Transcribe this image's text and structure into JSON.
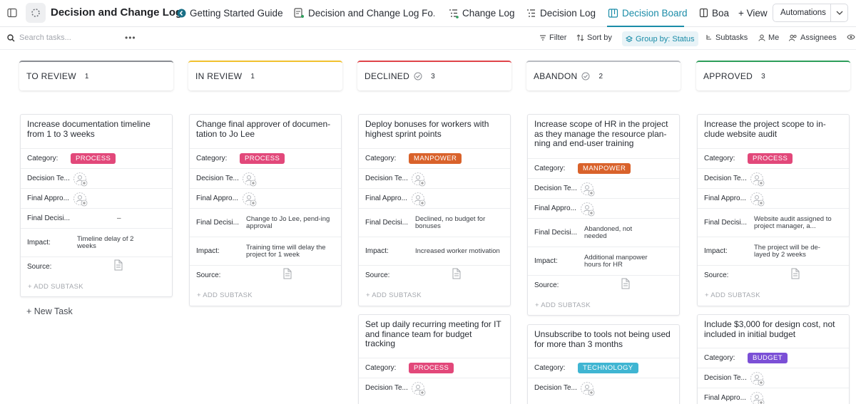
{
  "header": {
    "title": "Decision and Change Log",
    "tabs": [
      {
        "label": "Getting Started Guide",
        "icon": "getting-started-icon"
      },
      {
        "label": "Decision and Change Log Fo...",
        "icon": "form-icon"
      },
      {
        "label": "Change Log",
        "icon": "list-icon"
      },
      {
        "label": "Decision Log",
        "icon": "list-icon"
      },
      {
        "label": "Decision Board",
        "icon": "board-icon",
        "active": true
      },
      {
        "label": "Boa",
        "icon": "doc-icon"
      }
    ],
    "add_view": "+ View",
    "automations": "Automations"
  },
  "toolbar": {
    "search_placeholder": "Search tasks...",
    "more": "•••",
    "filter": "Filter",
    "sort": "Sort by",
    "group_by": "Group by: Status",
    "subtasks": "Subtasks",
    "me": "Me",
    "assignees": "Assignees"
  },
  "labels": {
    "category": "Category:",
    "decision_team": "Decision Te...",
    "final_approver": "Final Appro...",
    "final_decision": "Final Decisi...",
    "impact": "Impact:",
    "source": "Source:",
    "add_subtask": "+ ADD SUBTASK",
    "new_task": "+ New Task"
  },
  "colors": {
    "accent": "#1a8ca8",
    "process": "#e2487a",
    "manpower": "#d9622b",
    "technology": "#3fb5d2",
    "budget": "#7b4fd6"
  },
  "columns": [
    {
      "name": "TO REVIEW",
      "count": "1",
      "color": "#8a8d93",
      "check": false,
      "cards": [
        {
          "title": "Increase documentation timeline from 1 to 3 weeks",
          "category": "PROCESS",
          "final_decision": "–",
          "impact": "Timeline delay of 2 weeks"
        }
      ]
    },
    {
      "name": "IN REVIEW",
      "count": "1",
      "color": "#f2c230",
      "check": false,
      "cards": [
        {
          "title": "Change final approver of documen-tation to Jo Lee",
          "category": "PROCESS",
          "final_decision": "Change to Jo Lee, pend-ing approval",
          "impact": "Training time will delay the project for 1 week"
        }
      ]
    },
    {
      "name": "DECLINED",
      "count": "3",
      "color": "#e0454a",
      "check": true,
      "cards": [
        {
          "title": "Deploy bonuses for workers with highest sprint points",
          "category": "MANPOWER",
          "final_decision": "Declined, no budget for bonuses",
          "impact": "Increased worker motivation"
        },
        {
          "title": "Set up daily recurring meeting for IT and finance team for budget tracking",
          "category": "PROCESS"
        }
      ]
    },
    {
      "name": "ABANDON",
      "count": "2",
      "color": "#b9bcc2",
      "check": true,
      "cards": [
        {
          "title": "Increase scope of HR in the project as they manage the resource plan-ning and end-user training",
          "category": "MANPOWER",
          "final_decision": "Abandoned, not needed",
          "impact": "Additional manpower hours for HR"
        },
        {
          "title": "Unsubscribe to tools not being used for more than 3 months",
          "category": "TECHNOLOGY"
        }
      ]
    },
    {
      "name": "APPROVED",
      "count": "3",
      "color": "#2e9e5b",
      "check": false,
      "cards": [
        {
          "title": "Increase the project scope to in-clude website audit",
          "category": "PROCESS",
          "final_decision": "Website audit assigned to project manager, a...",
          "impact": "The project will be de-layed by 2 weeks"
        },
        {
          "title": "Include $3,000 for design cost, not included in initial budget",
          "category": "BUDGET"
        }
      ]
    }
  ]
}
